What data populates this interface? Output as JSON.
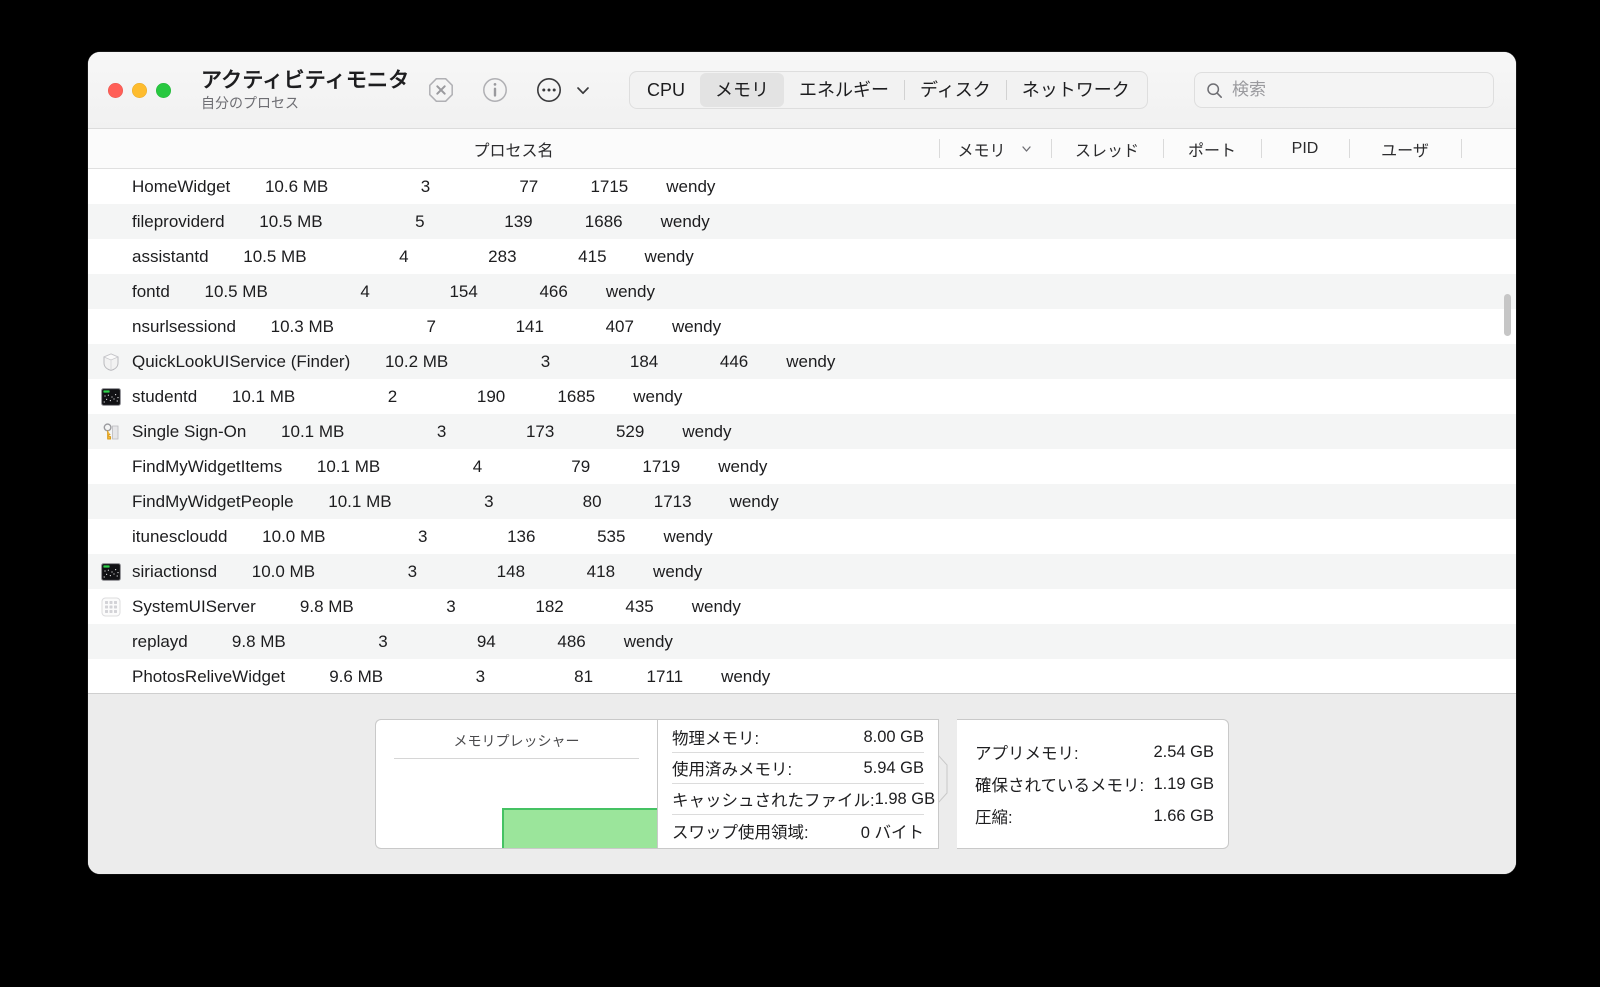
{
  "window": {
    "app_title": "アクティビティモニタ",
    "subtitle": "自分のプロセス",
    "traffic_lights": {
      "close": "close-button",
      "minimize": "minimize-button",
      "zoom": "zoom-button"
    }
  },
  "toolbar": {
    "quit_process_icon": "quit-process-icon",
    "inspect_icon": "inspect-process-icon",
    "more_icon": "more-options-icon",
    "chevron_icon": "chevron-down-icon",
    "tabs": [
      {
        "label": "CPU",
        "selected": false
      },
      {
        "label": "メモリ",
        "selected": true
      },
      {
        "label": "エネルギー",
        "selected": false
      },
      {
        "label": "ディスク",
        "selected": false
      },
      {
        "label": "ネットワーク",
        "selected": false
      }
    ],
    "search": {
      "placeholder": "検索",
      "value": "",
      "icon": "search-icon"
    }
  },
  "table": {
    "columns": [
      {
        "key": "name",
        "label": "プロセス名",
        "sorted": false
      },
      {
        "key": "memory",
        "label": "メモリ",
        "sorted": true,
        "sort_dir": "desc"
      },
      {
        "key": "threads",
        "label": "スレッド",
        "sorted": false
      },
      {
        "key": "ports",
        "label": "ポート",
        "sorted": false
      },
      {
        "key": "pid",
        "label": "PID",
        "sorted": false
      },
      {
        "key": "user",
        "label": "ユーザ",
        "sorted": false
      }
    ],
    "rows": [
      {
        "icon": "none",
        "name": "HomeWidget",
        "memory": "10.6 MB",
        "threads": "3",
        "ports": "77",
        "pid": "1715",
        "user": "wendy"
      },
      {
        "icon": "none",
        "name": "fileproviderd",
        "memory": "10.5 MB",
        "threads": "5",
        "ports": "139",
        "pid": "1686",
        "user": "wendy"
      },
      {
        "icon": "none",
        "name": "assistantd",
        "memory": "10.5 MB",
        "threads": "4",
        "ports": "283",
        "pid": "415",
        "user": "wendy"
      },
      {
        "icon": "none",
        "name": "fontd",
        "memory": "10.5 MB",
        "threads": "4",
        "ports": "154",
        "pid": "466",
        "user": "wendy"
      },
      {
        "icon": "none",
        "name": "nsurlsessiond",
        "memory": "10.3 MB",
        "threads": "7",
        "ports": "141",
        "pid": "407",
        "user": "wendy"
      },
      {
        "icon": "shield",
        "name": "QuickLookUIService (Finder)",
        "memory": "10.2 MB",
        "threads": "3",
        "ports": "184",
        "pid": "446",
        "user": "wendy"
      },
      {
        "icon": "terminal",
        "name": "studentd",
        "memory": "10.1 MB",
        "threads": "2",
        "ports": "190",
        "pid": "1685",
        "user": "wendy"
      },
      {
        "icon": "keychain",
        "name": "Single Sign-On",
        "memory": "10.1 MB",
        "threads": "3",
        "ports": "173",
        "pid": "529",
        "user": "wendy"
      },
      {
        "icon": "none",
        "name": "FindMyWidgetItems",
        "memory": "10.1 MB",
        "threads": "4",
        "ports": "79",
        "pid": "1719",
        "user": "wendy"
      },
      {
        "icon": "none",
        "name": "FindMyWidgetPeople",
        "memory": "10.1 MB",
        "threads": "3",
        "ports": "80",
        "pid": "1713",
        "user": "wendy"
      },
      {
        "icon": "none",
        "name": "itunescloudd",
        "memory": "10.0 MB",
        "threads": "3",
        "ports": "136",
        "pid": "535",
        "user": "wendy"
      },
      {
        "icon": "terminal",
        "name": "siriactionsd",
        "memory": "10.0 MB",
        "threads": "3",
        "ports": "148",
        "pid": "418",
        "user": "wendy"
      },
      {
        "icon": "grid",
        "name": "SystemUIServer",
        "memory": "9.8 MB",
        "threads": "3",
        "ports": "182",
        "pid": "435",
        "user": "wendy"
      },
      {
        "icon": "none",
        "name": "replayd",
        "memory": "9.8 MB",
        "threads": "3",
        "ports": "94",
        "pid": "486",
        "user": "wendy"
      },
      {
        "icon": "none",
        "name": "PhotosReliveWidget",
        "memory": "9.6 MB",
        "threads": "3",
        "ports": "81",
        "pid": "1711",
        "user": "wendy"
      }
    ]
  },
  "stats": {
    "pressure_title": "メモリプレッシャー",
    "left": [
      {
        "label": "物理メモリ:",
        "value": "8.00 GB"
      },
      {
        "label": "使用済みメモリ:",
        "value": "5.94 GB"
      },
      {
        "label": "キャッシュされたファイル:",
        "value": "1.98 GB"
      },
      {
        "label": "スワップ使用領域:",
        "value": "0 バイト"
      }
    ],
    "right": [
      {
        "label": "アプリメモリ:",
        "value": "2.54 GB"
      },
      {
        "label": "確保されているメモリ:",
        "value": "1.19 GB"
      },
      {
        "label": "圧縮:",
        "value": "1.66 GB"
      }
    ]
  },
  "colors": {
    "pressure_green_fill": "#9be59b",
    "pressure_green_stroke": "#45c263",
    "traffic_red": "#ff5f57",
    "traffic_yellow": "#febc2e",
    "traffic_green": "#28c840",
    "selected_tab_bg": "#e3e3e3",
    "alt_row_bg": "#f4f5f5"
  }
}
